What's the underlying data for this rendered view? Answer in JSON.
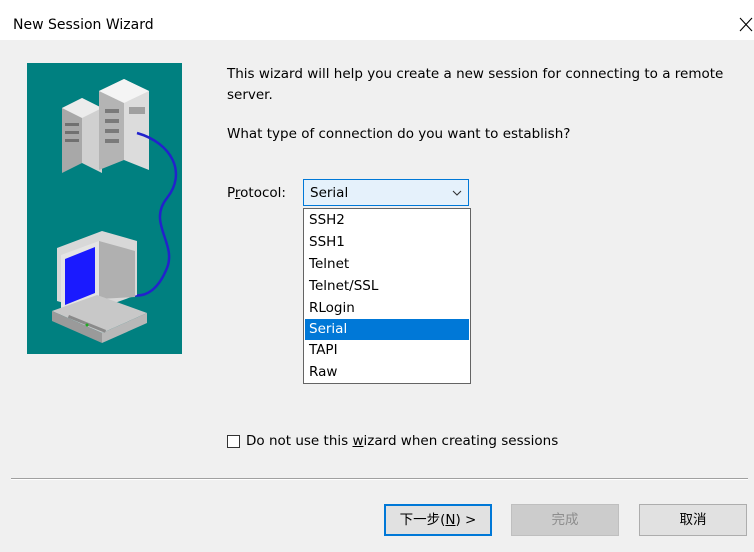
{
  "window": {
    "title": "New Session Wizard"
  },
  "intro": {
    "text": "This wizard will help you create a new session for connecting to a remote server.",
    "question": "What type of connection do you want to establish?"
  },
  "protocol": {
    "label_prefix": "P",
    "label_underlined": "r",
    "label_suffix": "otocol:",
    "selected": "Serial",
    "options": [
      "SSH2",
      "SSH1",
      "Telnet",
      "Telnet/SSL",
      "RLogin",
      "Serial",
      "TAPI",
      "Raw"
    ],
    "selected_index": 5
  },
  "wizard_option": {
    "label_prefix": "Do not use this ",
    "label_underlined": "w",
    "label_suffix": "izard when creating sessions",
    "checked": false
  },
  "buttons": {
    "next_prefix": "下一步(",
    "next_underlined": "N",
    "next_suffix": ") >",
    "finish": "完成",
    "cancel": "取消"
  },
  "colors": {
    "art_background": "#008080",
    "accent": "#0078d7"
  },
  "icons": {
    "close": "close-icon",
    "dropdown": "chevron-down-icon",
    "illustration": "server-computer-illustration"
  }
}
